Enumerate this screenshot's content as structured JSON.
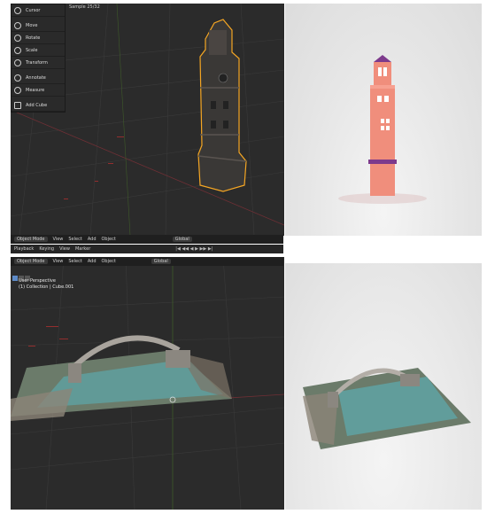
{
  "top_viewport": {
    "sample_label": "Sample 25/32",
    "toolbar": [
      {
        "label": "Cursor",
        "icon": "cursor-icon"
      },
      {
        "label": "Move",
        "icon": "move-icon"
      },
      {
        "label": "Rotate",
        "icon": "rotate-icon"
      },
      {
        "label": "Scale",
        "icon": "scale-icon"
      },
      {
        "label": "Transform",
        "icon": "transform-icon"
      },
      {
        "label": "Annotate",
        "icon": "annotate-icon"
      },
      {
        "label": "Measure",
        "icon": "measure-icon"
      },
      {
        "label": "Add Cube",
        "icon": "add-cube-icon"
      }
    ],
    "footer_header": {
      "mode": "Object Mode",
      "menus": [
        "View",
        "Select",
        "Add",
        "Object"
      ],
      "orientation": "Global"
    }
  },
  "timeline": {
    "menus": [
      "Playback",
      "Keying",
      "View",
      "Marker"
    ]
  },
  "bottom_viewport": {
    "header": {
      "mode": "Object Mode",
      "menus": [
        "View",
        "Select",
        "Add",
        "Object"
      ],
      "orientation": "Global"
    },
    "overlay": {
      "perspective": "User Perspective",
      "collection": "(1) Collection | Cube.001"
    }
  },
  "colors": {
    "viewport_bg": "#2b2b2b",
    "header_bg": "#1f1f1f",
    "tower_render": "#f08e7c",
    "tower_roof": "#7d3a8c",
    "selection_outline": "#f5a623",
    "render_bg": "#e9e9e9"
  }
}
